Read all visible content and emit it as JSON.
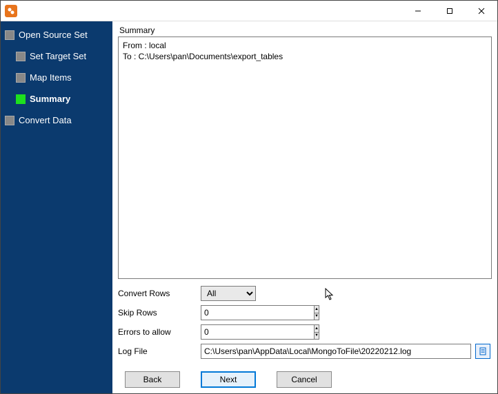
{
  "titlebar": {
    "title": ""
  },
  "sidebar": {
    "items": [
      {
        "label": "Open Source Set",
        "child": false,
        "active": false
      },
      {
        "label": "Set Target Set",
        "child": true,
        "active": false
      },
      {
        "label": "Map Items",
        "child": true,
        "active": false
      },
      {
        "label": "Summary",
        "child": true,
        "active": true
      },
      {
        "label": "Convert Data",
        "child": false,
        "active": false
      }
    ]
  },
  "main": {
    "section_label": "Summary",
    "summary_text": "From : local\nTo : C:\\Users\\pan\\Documents\\export_tables",
    "convert_rows": {
      "label": "Convert Rows",
      "value": "All",
      "options": [
        "All"
      ]
    },
    "skip_rows": {
      "label": "Skip Rows",
      "value": "0"
    },
    "errors_allow": {
      "label": "Errors to allow",
      "value": "0"
    },
    "log_file": {
      "label": "Log File",
      "value": "C:\\Users\\pan\\AppData\\Local\\MongoToFile\\20220212.log"
    }
  },
  "buttons": {
    "back": "Back",
    "next": "Next",
    "cancel": "Cancel"
  }
}
